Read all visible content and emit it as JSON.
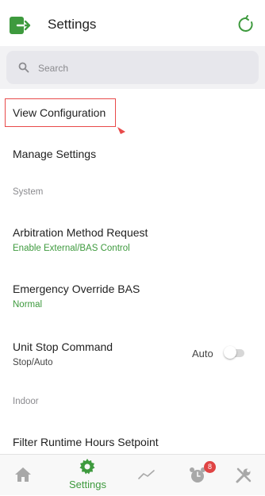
{
  "header": {
    "title": "Settings"
  },
  "search": {
    "placeholder": "Search"
  },
  "items": {
    "view_configuration": "View Configuration",
    "manage_settings": "Manage Settings",
    "section_system": "System",
    "arbitration": {
      "label": "Arbitration Method Request",
      "value": "Enable External/BAS Control"
    },
    "emergency": {
      "label": "Emergency Override BAS",
      "value": "Normal"
    },
    "unit_stop": {
      "label": "Unit Stop Command",
      "value": "Stop/Auto",
      "toggle_label": "Auto",
      "toggle_on": false
    },
    "section_indoor": "Indoor",
    "filter_runtime": "Filter Runtime Hours Setpoint"
  },
  "tabbar": {
    "tabs": [
      {
        "icon": "home-icon"
      },
      {
        "icon": "gear-icon",
        "label": "Settings",
        "active": true
      },
      {
        "icon": "trend-icon"
      },
      {
        "icon": "alarm-icon",
        "badge": "8"
      },
      {
        "icon": "tools-icon"
      }
    ]
  },
  "colors": {
    "accent": "#3e9a3e",
    "badge": "#e04444",
    "highlight": "#e84a4a"
  }
}
